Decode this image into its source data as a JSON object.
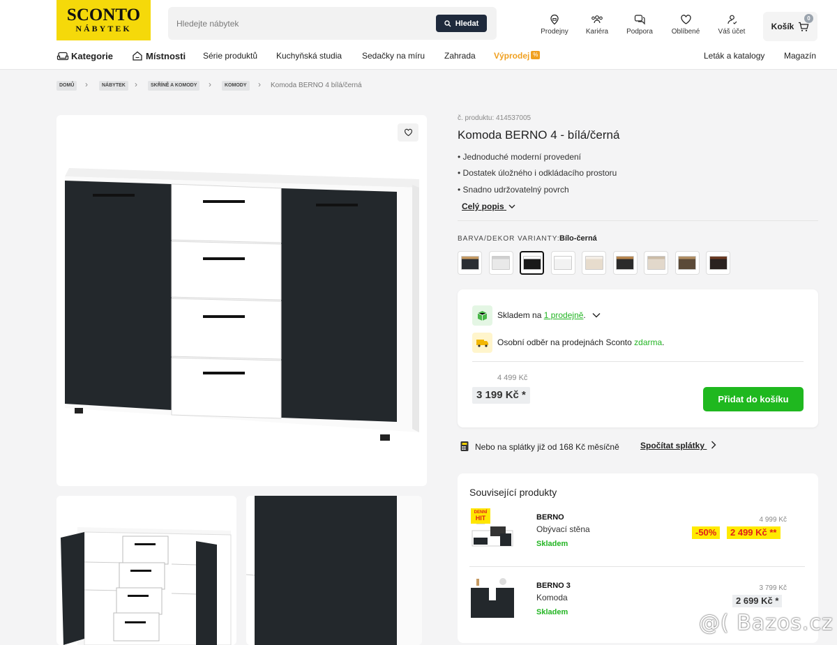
{
  "header": {
    "logo_line1": "SCONTO",
    "logo_line2": "NÁBYTEK",
    "search_placeholder": "Hledejte nábytek",
    "search_button": "Hledat",
    "icons": [
      {
        "label": "Prodejny",
        "icon": "store-pin-icon"
      },
      {
        "label": "Kariéra",
        "icon": "people-icon"
      },
      {
        "label": "Podpora",
        "icon": "chat-icon"
      },
      {
        "label": "Oblíbené",
        "icon": "heart-icon"
      },
      {
        "label": "Váš účet",
        "icon": "user-icon"
      }
    ],
    "cart_label": "Košík",
    "cart_count": "0"
  },
  "nav": {
    "kategorie": "Kategorie",
    "mistnosti": "Místnosti",
    "items": [
      "Série produktů",
      "Kuchyňská studia",
      "Sedačky na míru",
      "Zahrada"
    ],
    "sale": "Výprodej",
    "sale_tag": "%",
    "right": [
      "Leták a katalogy",
      "Magazín"
    ]
  },
  "breadcrumb": {
    "items": [
      "DOMŮ",
      "NÁBYTEK",
      "SKŘÍNĚ A KOMODY",
      "KOMODY"
    ],
    "current": "Komoda BERNO 4 bílá/černá"
  },
  "product": {
    "code": "č. produktu: 414537005",
    "title": "Komoda BERNO 4 - bílá/černá",
    "bullets": [
      "Jednoduché moderní provedení",
      "Dostatek úložného i odkládacího prostoru",
      "Snadno udržovatelný povrch"
    ],
    "full_desc": "Celý popis",
    "variant_label": "BARVA/DEKOR VARIANTY:",
    "variant_value": "Bílo-černá",
    "swatches": [
      {
        "front": "#2a2e33",
        "top": "#c69a62"
      },
      {
        "front": "#e9e9e9",
        "top": "#cfcfcf"
      },
      {
        "front": "#1a1a1a",
        "top": "#ffffff"
      },
      {
        "front": "#f2f2f2",
        "top": "#ffffff"
      },
      {
        "front": "#e7dccd",
        "top": "#f4eee6"
      },
      {
        "front": "#2b2b2b",
        "top": "#b8864e"
      },
      {
        "front": "#e2d8cb",
        "top": "#cbbba7"
      },
      {
        "front": "#5b4a38",
        "top": "#b08d62"
      },
      {
        "front": "#2a2220",
        "top": "#6b3a22"
      }
    ]
  },
  "buy": {
    "stock_prefix": "Skladem na ",
    "stock_link": "1 prodejně",
    "stock_suffix": ".",
    "pickup_prefix": "Osobní odběr na prodejnách Sconto ",
    "pickup_free": "zdarma",
    "pickup_suffix": ".",
    "old_price": "4 499 Kč",
    "price": "3 199 Kč *",
    "add_button": "Přidat do košíku",
    "installment_text": "Nebo na splátky již od 168 Kč měsíčně",
    "installment_link": "Spočítat splátky"
  },
  "related": {
    "title": "Související produkty",
    "items": [
      {
        "name": "BERNO",
        "sub": "Obývací stěna",
        "stock": "Skladem",
        "old": "4 999 Kč",
        "discount": "-50%",
        "price": "2 499 Kč **",
        "badge_line1": "DENNÍ",
        "badge_line2": "HIT"
      },
      {
        "name": "BERNO 3",
        "sub": "Komoda",
        "stock": "Skladem",
        "old": "3 799 Kč",
        "price": "2 699 Kč *"
      }
    ]
  },
  "watermark": "@( Bazos.cz",
  "colors": {
    "accent_green": "#1fb81f",
    "logo_yellow": "#f5d90a",
    "sale_orange": "#f0a020",
    "search_button": "#1f2a3c"
  }
}
